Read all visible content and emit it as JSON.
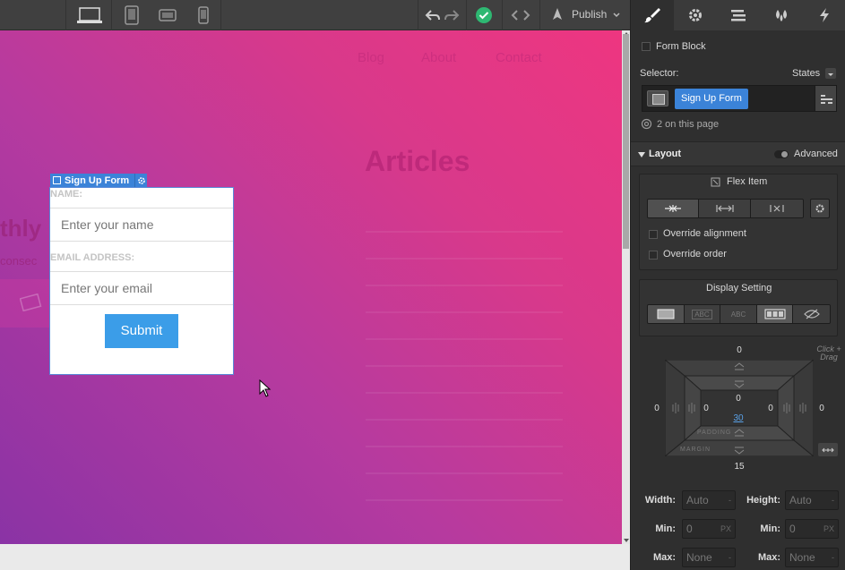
{
  "topbar": {
    "publish_label": "Publish"
  },
  "canvas": {
    "nav": [
      "Blog",
      "About",
      "Contact"
    ],
    "heading": "Articles",
    "ghost_heading": "thly",
    "ghost_text": "consec"
  },
  "form": {
    "tag_label": "Sign Up Form",
    "name_label": "NAME:",
    "name_placeholder": "Enter your name",
    "email_label": "EMAIL ADDRESS:",
    "email_placeholder": "Enter your email",
    "submit_label": "Submit"
  },
  "panel": {
    "element_type": "Form Block",
    "selector_label": "Selector:",
    "states_label": "States",
    "selector_chip": "Sign Up Form",
    "on_page": "2 on this page",
    "layout_label": "Layout",
    "advanced_label": "Advanced",
    "flex_item_label": "Flex Item",
    "override_alignment": "Override alignment",
    "override_order": "Override order",
    "display_setting_label": "Display Setting",
    "display_abc1": "ABC",
    "display_abc2": "ABC",
    "click_drag_hint": "Click + Drag",
    "box": {
      "margin_top": "0",
      "margin_left": "0",
      "margin_right": "0",
      "margin_bottom": "15",
      "padding_top": "0",
      "padding_left": "0",
      "padding_right": "0",
      "padding_bottom": "30",
      "padding_label": "PADDING",
      "margin_label": "MARGIN"
    },
    "width_label": "Width:",
    "width_value": "Auto",
    "height_label": "Height:",
    "height_value": "Auto",
    "min_label": "Min:",
    "min_w_value": "0",
    "min_h_value": "0",
    "min_unit": "PX",
    "max_label": "Max:",
    "max_w_value": "None",
    "max_h_value": "None",
    "dash": "-"
  },
  "colors": {
    "accent": "#3b83d8",
    "submit": "#3b9de8",
    "status_ok": "#2eb872"
  }
}
